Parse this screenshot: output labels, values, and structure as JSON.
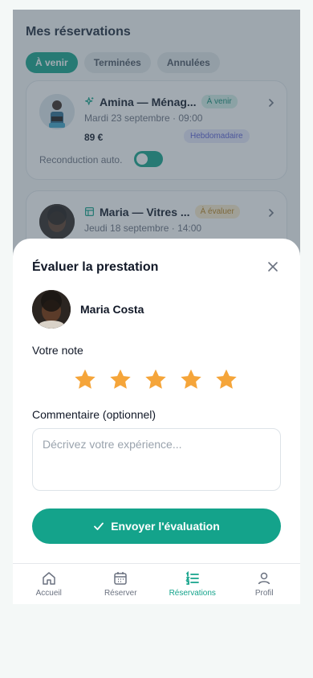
{
  "colors": {
    "accent": "#14a38b",
    "star": "#f5a53a"
  },
  "page": {
    "title": "Mes réservations",
    "filters": [
      {
        "label": "À venir",
        "active": true
      },
      {
        "label": "Terminées",
        "active": false
      },
      {
        "label": "Annulées",
        "active": false
      }
    ]
  },
  "bookings": [
    {
      "title": "Amina — Ménag...",
      "service_icon": "sparkles-icon",
      "status": "À venir",
      "date": "Mardi 23 septembre · 09:00",
      "price": "89 €",
      "frequency": "Hebdomadaire",
      "renewal_label": "Reconduction auto.",
      "renewal_on": true
    },
    {
      "title": "Maria — Vitres ...",
      "service_icon": "window-icon",
      "status": "À évaluer",
      "date": "Jeudi 18 septembre · 14:00"
    }
  ],
  "rating_sheet": {
    "title": "Évaluer la prestation",
    "provider_name": "Maria Costa",
    "rating_label": "Votre note",
    "rating": 5,
    "rating_max": 5,
    "comment_label": "Commentaire (optionnel)",
    "comment_placeholder": "Décrivez votre expérience...",
    "comment_value": "",
    "submit_label": "Envoyer l'évaluation"
  },
  "tabbar": [
    {
      "label": "Accueil",
      "icon": "home-icon",
      "active": false
    },
    {
      "label": "Réserver",
      "icon": "calendar-icon",
      "active": false
    },
    {
      "label": "Réservations",
      "icon": "list-icon",
      "active": true
    },
    {
      "label": "Profil",
      "icon": "user-icon",
      "active": false
    }
  ]
}
